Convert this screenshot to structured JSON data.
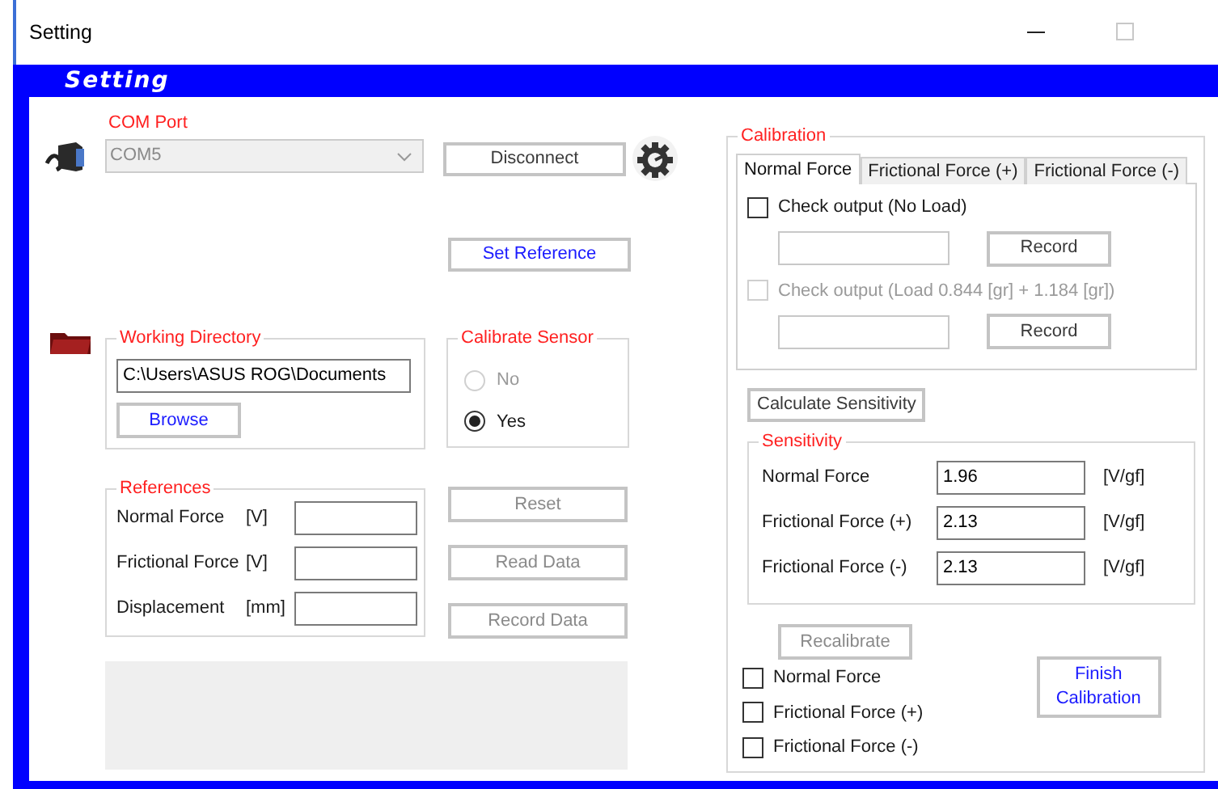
{
  "window": {
    "title": "Setting"
  },
  "header": {
    "title": "Setting"
  },
  "com_port": {
    "label": "COM Port",
    "value": "COM5",
    "disabled": true
  },
  "disconnect_button": {
    "label": "Disconnect",
    "disabled": false,
    "accent": false
  },
  "set_reference_button": {
    "label": "Set Reference",
    "disabled": false,
    "accent": true
  },
  "working_directory": {
    "title": "Working Directory",
    "path": "C:\\Users\\ASUS ROG\\Documents",
    "browse_button": {
      "label": "Browse",
      "disabled": false,
      "accent": true
    }
  },
  "calibrate_sensor": {
    "title": "Calibrate Sensor",
    "options": [
      {
        "label": "No",
        "selected": false,
        "disabled": true
      },
      {
        "label": "Yes",
        "selected": true,
        "disabled": false
      }
    ]
  },
  "references": {
    "title": "References",
    "rows": [
      {
        "label": "Normal Force",
        "unit": "[V]"
      },
      {
        "label": "Frictional Force",
        "unit": "[V]"
      },
      {
        "label": "Displacement",
        "unit": "[mm]"
      }
    ]
  },
  "actions": [
    {
      "label": "Reset",
      "disabled": true,
      "accent": false
    },
    {
      "label": "Read Data",
      "disabled": true,
      "accent": false
    },
    {
      "label": "Record Data",
      "disabled": true,
      "accent": false
    }
  ],
  "calibration": {
    "title": "Calibration",
    "tabs": [
      {
        "label": "Normal Force",
        "selected": true
      },
      {
        "label": "Frictional Force (+)",
        "selected": false
      },
      {
        "label": "Frictional Force (-)",
        "selected": false
      }
    ],
    "checks": [
      {
        "label": "Check output (No Load)",
        "checked": false,
        "disabled": false,
        "button": {
          "label": "Record",
          "disabled": false,
          "accent": false
        }
      },
      {
        "label": "Check output (Load 0.844 [gr] + 1.184 [gr])",
        "checked": false,
        "disabled": true,
        "button": {
          "label": "Record",
          "disabled": false,
          "accent": false
        }
      }
    ],
    "calculate_button": {
      "label": "Calculate Sensitivity",
      "disabled": false,
      "accent": false
    },
    "sensitivity": {
      "title": "Sensitivity",
      "rows": [
        {
          "label": "Normal Force",
          "value": "1.96",
          "unit": "[V/gf]"
        },
        {
          "label": "Frictional Force (+)",
          "value": "2.13",
          "unit": "[V/gf]"
        },
        {
          "label": "Frictional Force (-)",
          "value": "2.13",
          "unit": "[V/gf]"
        }
      ]
    },
    "recalibrate_button": {
      "label": "Recalibrate",
      "disabled": true,
      "accent": false
    },
    "recalibrate_options": [
      {
        "label": "Normal Force",
        "checked": false
      },
      {
        "label": "Frictional Force (+)",
        "checked": false
      },
      {
        "label": "Frictional Force (-)",
        "checked": false
      }
    ],
    "finish_button": {
      "label": "Finish Calibration",
      "disabled": false,
      "accent": true
    }
  }
}
